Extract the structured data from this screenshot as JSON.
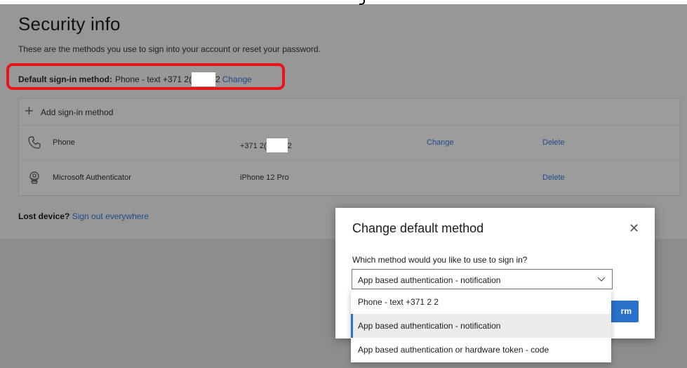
{
  "page": {
    "title": "Security info",
    "subtitle": "These are the methods you use to sign into your account or reset your password."
  },
  "default_method": {
    "label": "Default sign-in method:",
    "value_prefix": "Phone - text +371 2(",
    "value_suffix": "2",
    "change_label": "Change"
  },
  "methods": {
    "add_label": "Add sign-in method",
    "rows": [
      {
        "icon": "phone-icon",
        "name": "Phone",
        "detail_prefix": "+371 2(",
        "detail_suffix": "2",
        "change": "Change",
        "delete": "Delete"
      },
      {
        "icon": "authenticator-icon",
        "name": "Microsoft Authenticator",
        "detail": "iPhone 12 Pro",
        "delete": "Delete"
      }
    ]
  },
  "lost_device": {
    "label": "Lost device?",
    "link": "Sign out everywhere"
  },
  "dialog": {
    "title": "Change default method",
    "question": "Which method would you like to use to sign in?",
    "selected": "App based authentication - notification",
    "confirm_partial": "rm",
    "options": [
      "Phone - text +371 2              2",
      "App based authentication - notification",
      "App based authentication or hardware token - code"
    ]
  },
  "colors": {
    "accent": "#2c71c9",
    "link": "#204a89",
    "highlight": "#e8141a"
  }
}
